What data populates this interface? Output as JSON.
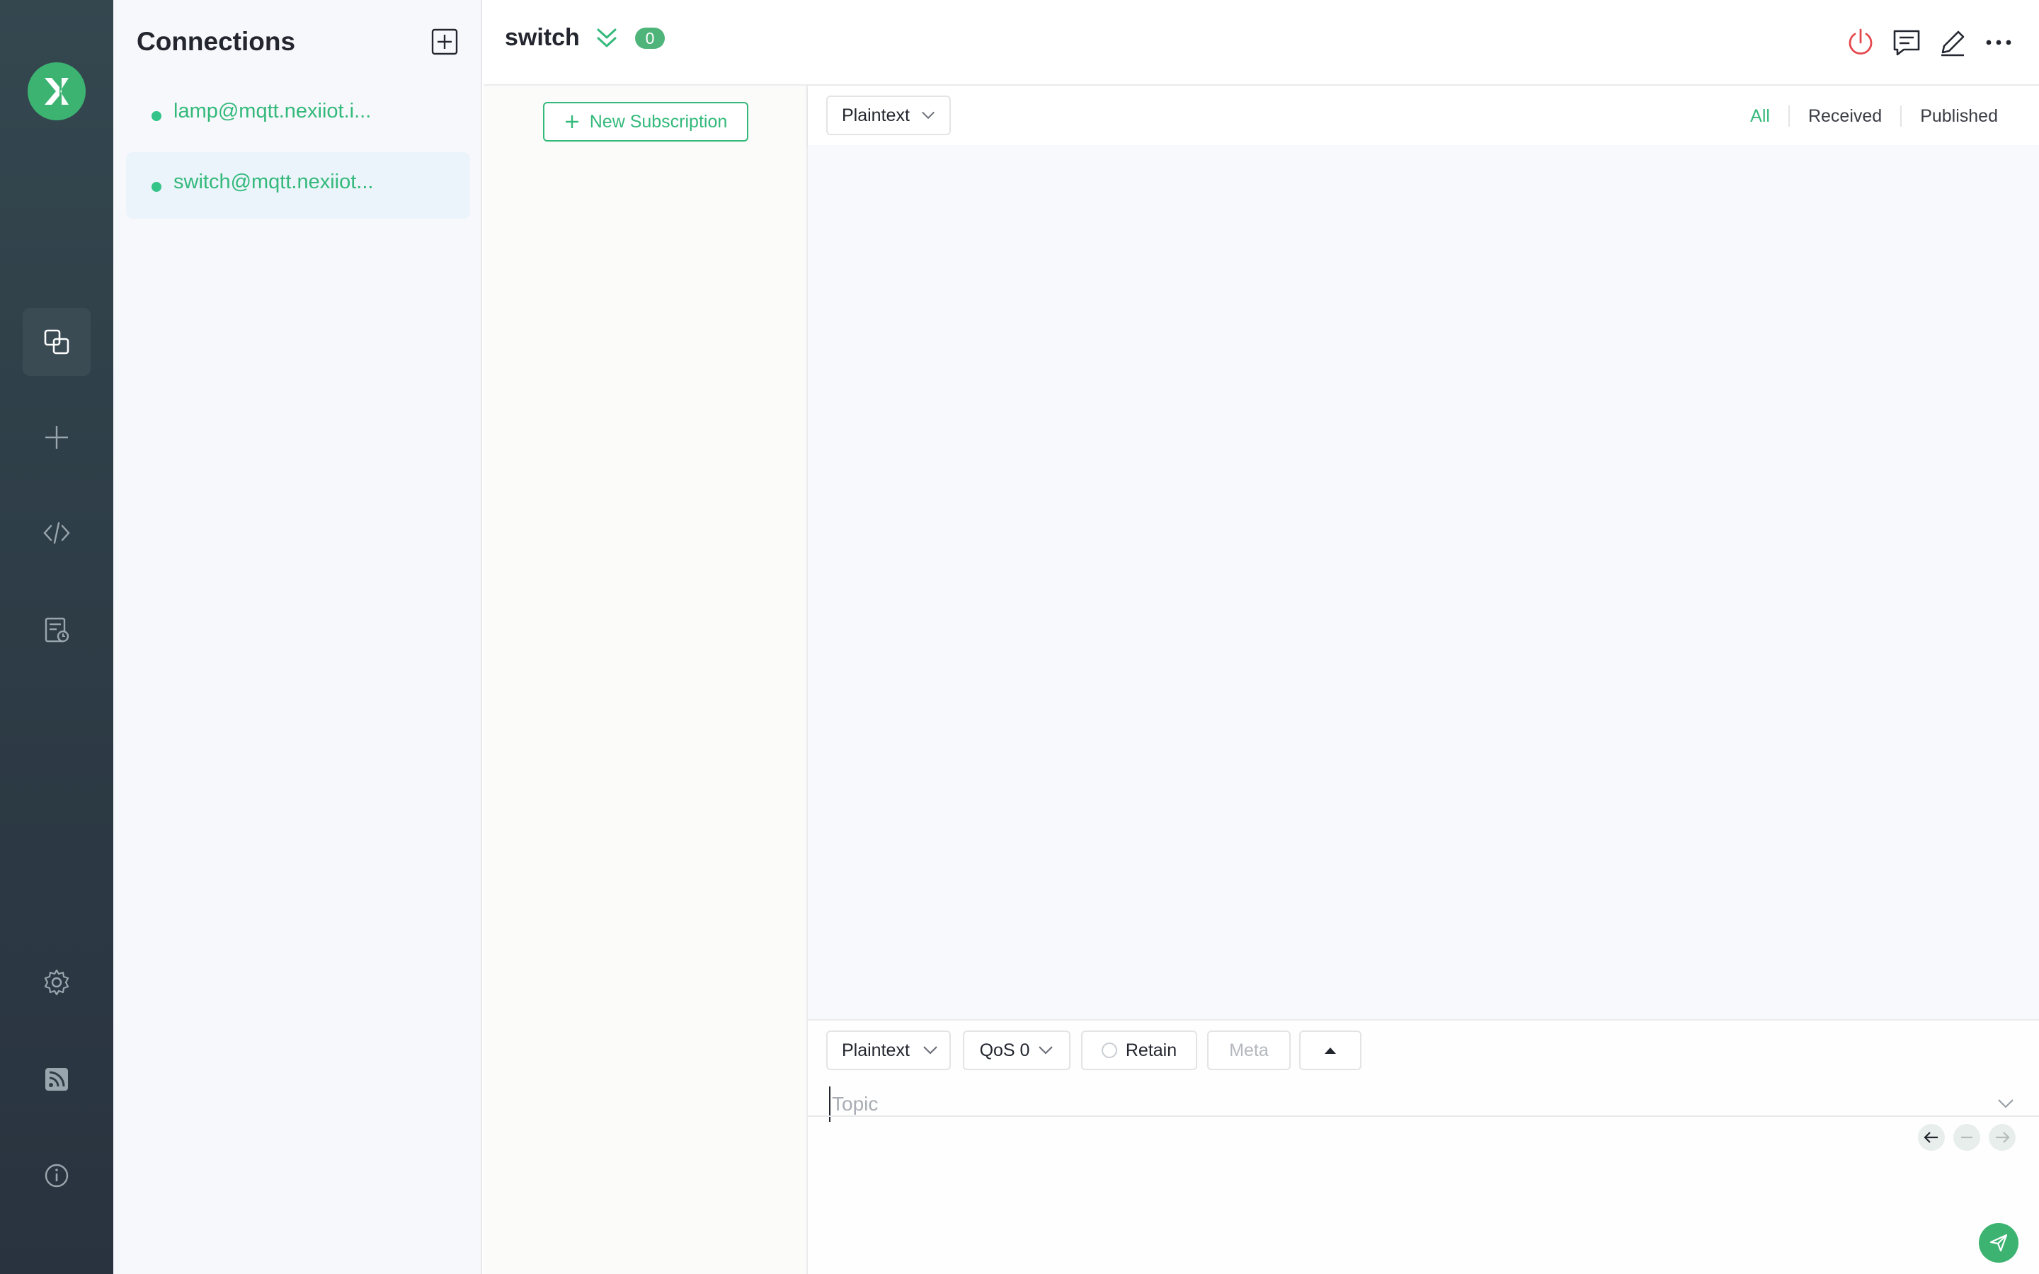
{
  "colors": {
    "accent": "#34b97b",
    "rail_bg": "#2e3d47",
    "disconnect": "#e5484d"
  },
  "rail": {
    "items": [
      {
        "icon": "connections-icon",
        "active": true
      },
      {
        "icon": "plus-icon"
      },
      {
        "icon": "code-icon"
      },
      {
        "icon": "log-icon"
      },
      {
        "icon": "gear-icon"
      },
      {
        "icon": "rss-icon"
      },
      {
        "icon": "info-icon"
      }
    ]
  },
  "connections": {
    "title": "Connections",
    "items": [
      {
        "name": "lamp@mqtt.nexiiot.i...",
        "status": "connected"
      },
      {
        "name": "switch@mqtt.nexiiot...",
        "status": "connected",
        "active": true
      }
    ]
  },
  "topbar": {
    "title": "switch",
    "badge_count": "0",
    "icons": [
      "power-icon",
      "chat-icon",
      "edit-icon",
      "more-icon"
    ]
  },
  "subscriptions": {
    "new_label": "New Subscription"
  },
  "messages": {
    "format": "Plaintext",
    "filters": [
      {
        "label": "All",
        "active": true
      },
      {
        "label": "Received"
      },
      {
        "label": "Published"
      }
    ]
  },
  "publish": {
    "format": "Plaintext",
    "qos": "QoS 0",
    "retain_label": "Retain",
    "meta_label": "Meta",
    "topic_placeholder": "Topic"
  }
}
